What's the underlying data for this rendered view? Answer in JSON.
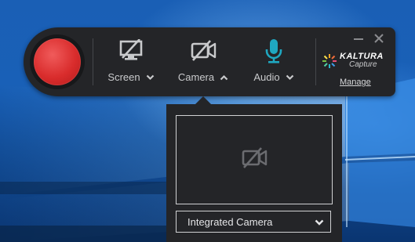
{
  "toolbar": {
    "record_button_color": "#d92c2c",
    "sources": [
      {
        "label": "Screen",
        "icon": "screen-off-icon",
        "chevron": "down"
      },
      {
        "label": "Camera",
        "icon": "camera-off-icon",
        "chevron": "up"
      },
      {
        "label": "Audio",
        "icon": "microphone-icon",
        "chevron": "down",
        "color": "#1fa7c0"
      }
    ],
    "brand": {
      "name": "KALTURA",
      "subtitle": "Capture"
    },
    "manage_label": "Manage"
  },
  "camera_popup": {
    "preview_icon": "camera-off-icon",
    "selected_device": "Integrated Camera"
  },
  "colors": {
    "toolbar_bg": "#242528",
    "accent_teal": "#1fa7c0",
    "text_light": "#c9cacc"
  }
}
